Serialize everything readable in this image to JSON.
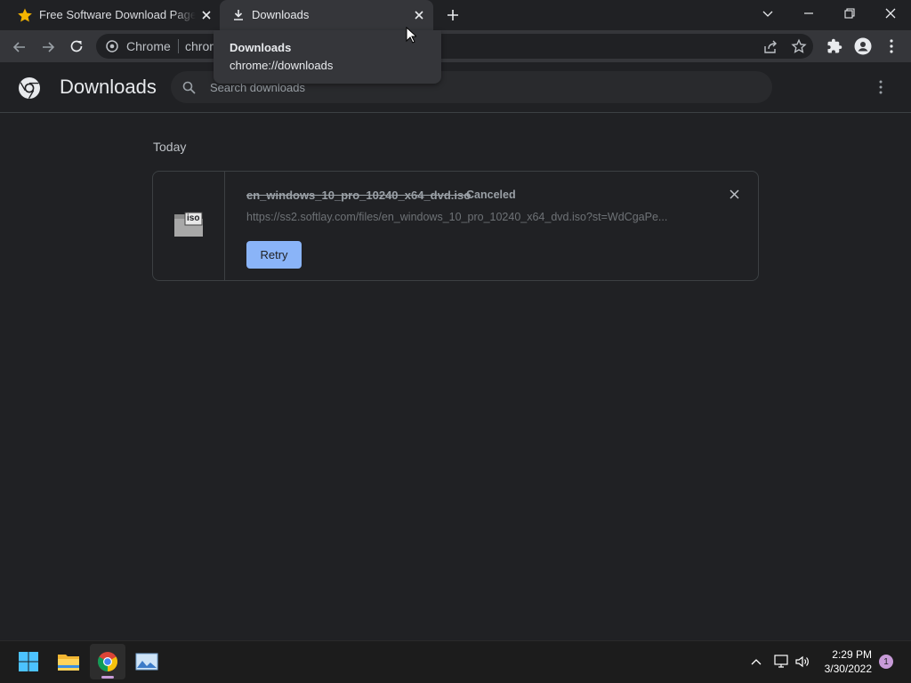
{
  "browser": {
    "tabs": [
      {
        "label": "Free Software Download Page - Softlay",
        "icon": "star-icon"
      },
      {
        "label": "Downloads",
        "icon": "download-icon"
      }
    ],
    "omnibox": {
      "site_label": "Chrome",
      "url_text": "chrome://downloads"
    }
  },
  "tooltip": {
    "title": "Downloads",
    "url": "chrome://downloads"
  },
  "page": {
    "title": "Downloads",
    "search_placeholder": "Search downloads",
    "section_label": "Today"
  },
  "download": {
    "file_name": "en_windows_10_pro_10240_x64_dvd.iso",
    "status": "Canceled",
    "url": "https://ss2.softlay.com/files/en_windows_10_pro_10240_x64_dvd.iso?st=WdCgaPe...",
    "retry_label": "Retry",
    "file_icon_label": "iso"
  },
  "taskbar": {
    "time": "2:29 PM",
    "date": "3/30/2022",
    "notification_count": "1"
  },
  "colors": {
    "accent": "#8ab4f8",
    "background": "#202124",
    "toolbar": "#35363a"
  }
}
